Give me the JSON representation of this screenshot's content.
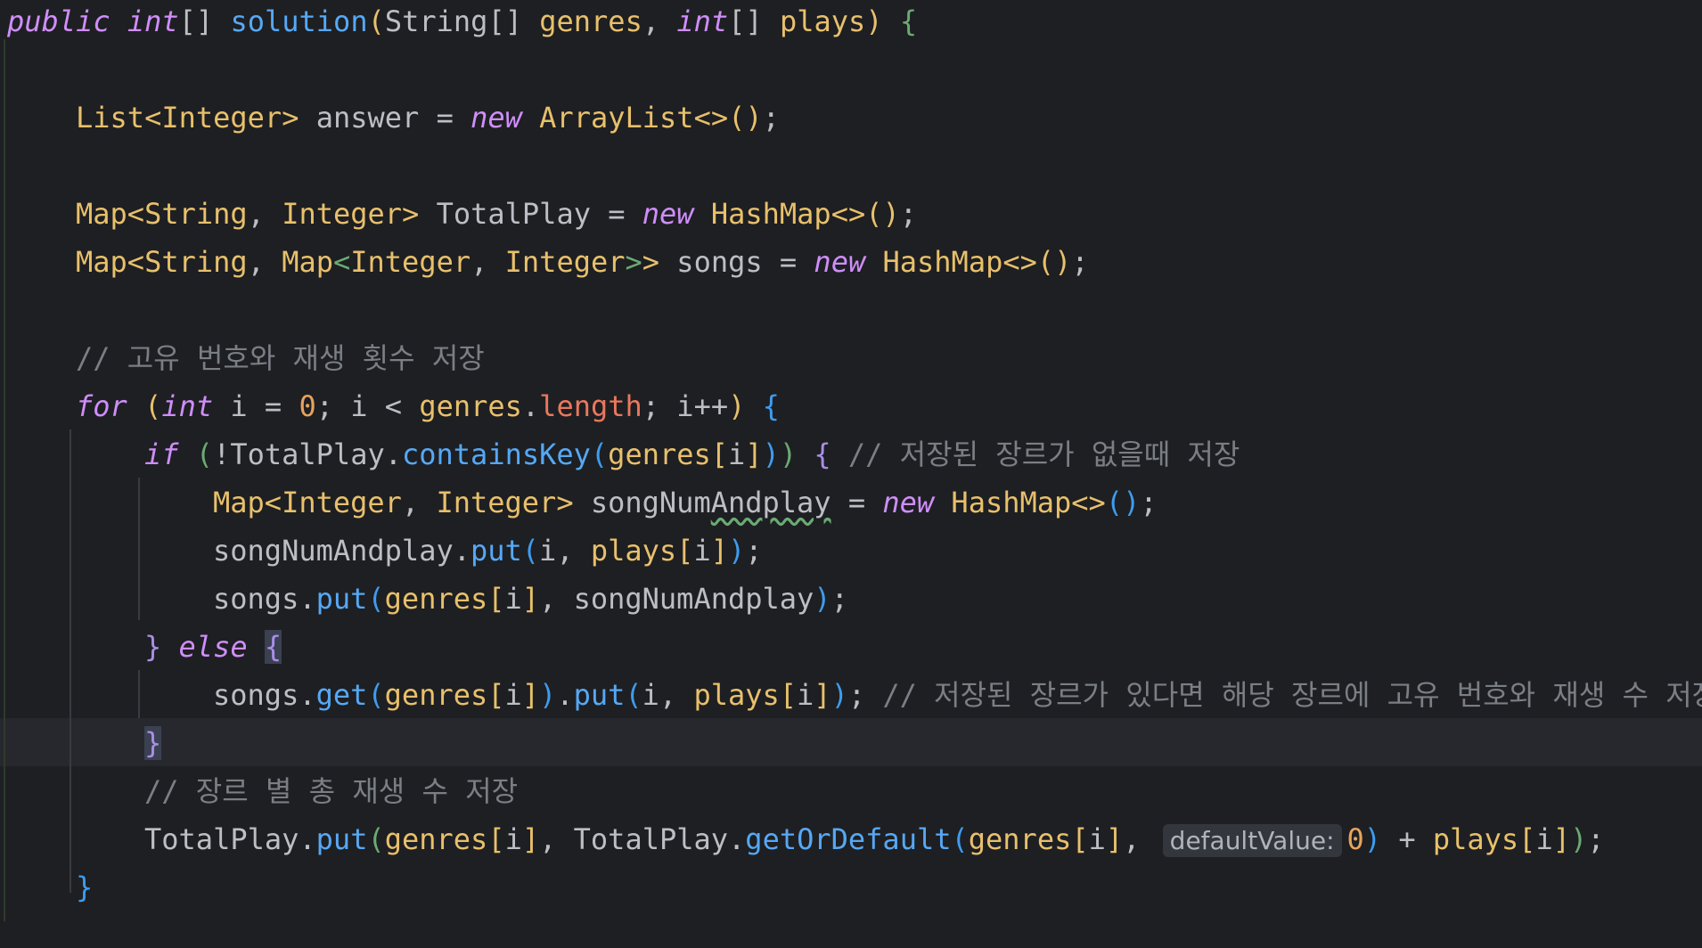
{
  "editor": {
    "lines": [
      {
        "indent": 0,
        "tokens": [
          {
            "t": "public",
            "c": "kw"
          },
          {
            "t": " ",
            "c": "var"
          },
          {
            "t": "int",
            "c": "kw"
          },
          {
            "t": "[] ",
            "c": "var"
          },
          {
            "t": "solution",
            "c": "fn"
          },
          {
            "t": "(",
            "c": "brY"
          },
          {
            "t": "String",
            "c": "var"
          },
          {
            "t": "[] ",
            "c": "var"
          },
          {
            "t": "genres",
            "c": "type"
          },
          {
            "t": ", ",
            "c": "var"
          },
          {
            "t": "int",
            "c": "kw"
          },
          {
            "t": "[] ",
            "c": "var"
          },
          {
            "t": "plays",
            "c": "type"
          },
          {
            "t": ") ",
            "c": "brY"
          },
          {
            "t": "{",
            "c": "brG"
          }
        ]
      },
      {
        "indent": 0,
        "tokens": []
      },
      {
        "indent": 1,
        "tokens": [
          {
            "t": "List<Integer>",
            "c": "type"
          },
          {
            "t": " answer = ",
            "c": "var"
          },
          {
            "t": "new",
            "c": "kw"
          },
          {
            "t": " ",
            "c": "var"
          },
          {
            "t": "ArrayList<>()",
            "c": "type"
          },
          {
            "t": ";",
            "c": "var"
          }
        ]
      },
      {
        "indent": 0,
        "tokens": []
      },
      {
        "indent": 1,
        "tokens": [
          {
            "t": "Map<String",
            "c": "type"
          },
          {
            "t": ", ",
            "c": "var"
          },
          {
            "t": "Integer>",
            "c": "type"
          },
          {
            "t": " TotalPlay = ",
            "c": "var"
          },
          {
            "t": "new",
            "c": "kw"
          },
          {
            "t": " ",
            "c": "var"
          },
          {
            "t": "HashMap<>()",
            "c": "type"
          },
          {
            "t": ";",
            "c": "var"
          }
        ]
      },
      {
        "indent": 1,
        "tokens": [
          {
            "t": "Map<String",
            "c": "type"
          },
          {
            "t": ", ",
            "c": "var"
          },
          {
            "t": "Map",
            "c": "type"
          },
          {
            "t": "<",
            "c": "brG"
          },
          {
            "t": "Integer",
            "c": "type"
          },
          {
            "t": ", ",
            "c": "var"
          },
          {
            "t": "Integer",
            "c": "type"
          },
          {
            "t": ">",
            "c": "brG"
          },
          {
            "t": ">",
            "c": "type"
          },
          {
            "t": " songs = ",
            "c": "var"
          },
          {
            "t": "new",
            "c": "kw"
          },
          {
            "t": " ",
            "c": "var"
          },
          {
            "t": "HashMap<>()",
            "c": "type"
          },
          {
            "t": ";",
            "c": "var"
          }
        ]
      },
      {
        "indent": 0,
        "tokens": []
      },
      {
        "indent": 1,
        "tokens": [
          {
            "t": "// 고유 번호와 재생 횟수 저장",
            "c": "cmt"
          }
        ]
      },
      {
        "indent": 1,
        "tokens": [
          {
            "t": "for",
            "c": "kw"
          },
          {
            "t": " ",
            "c": "var"
          },
          {
            "t": "(",
            "c": "brY"
          },
          {
            "t": "int",
            "c": "kw"
          },
          {
            "t": " i = ",
            "c": "var"
          },
          {
            "t": "0",
            "c": "num"
          },
          {
            "t": "; i < ",
            "c": "var"
          },
          {
            "t": "genres",
            "c": "type"
          },
          {
            "t": ".",
            "c": "var"
          },
          {
            "t": "length",
            "c": "fld"
          },
          {
            "t": "; i++",
            "c": "var"
          },
          {
            "t": ") ",
            "c": "brY"
          },
          {
            "t": "{",
            "c": "brB"
          }
        ]
      },
      {
        "indent": 2,
        "tokens": [
          {
            "t": "if",
            "c": "kw"
          },
          {
            "t": " ",
            "c": "var"
          },
          {
            "t": "(",
            "c": "brG"
          },
          {
            "t": "!TotalPlay.",
            "c": "var"
          },
          {
            "t": "containsKey",
            "c": "fn"
          },
          {
            "t": "(",
            "c": "brB"
          },
          {
            "t": "genres",
            "c": "type"
          },
          {
            "t": "[",
            "c": "brY"
          },
          {
            "t": "i",
            "c": "var"
          },
          {
            "t": "]",
            "c": "brY"
          },
          {
            "t": ")",
            "c": "brB"
          },
          {
            "t": ") ",
            "c": "brG"
          },
          {
            "t": "{",
            "c": "brP"
          },
          {
            "t": " ",
            "c": "var"
          },
          {
            "t": "// 저장된 장르가 없을때 저장",
            "c": "cmt"
          }
        ]
      },
      {
        "indent": 3,
        "tokens": [
          {
            "t": "Map<Integer",
            "c": "type"
          },
          {
            "t": ", ",
            "c": "var"
          },
          {
            "t": "Integer>",
            "c": "type"
          },
          {
            "t": " songNum",
            "c": "var"
          },
          {
            "t": "Andplay",
            "c": "typo"
          },
          {
            "t": " = ",
            "c": "var"
          },
          {
            "t": "new",
            "c": "kw"
          },
          {
            "t": " ",
            "c": "var"
          },
          {
            "t": "HashMap<>",
            "c": "type"
          },
          {
            "t": "()",
            "c": "brB"
          },
          {
            "t": ";",
            "c": "var"
          }
        ]
      },
      {
        "indent": 3,
        "tokens": [
          {
            "t": "songNumAndplay.",
            "c": "var"
          },
          {
            "t": "put",
            "c": "fn"
          },
          {
            "t": "(",
            "c": "brB"
          },
          {
            "t": "i, ",
            "c": "var"
          },
          {
            "t": "plays",
            "c": "type"
          },
          {
            "t": "[",
            "c": "brY"
          },
          {
            "t": "i",
            "c": "var"
          },
          {
            "t": "]",
            "c": "brY"
          },
          {
            "t": ")",
            "c": "brB"
          },
          {
            "t": ";",
            "c": "var"
          }
        ]
      },
      {
        "indent": 3,
        "tokens": [
          {
            "t": "songs.",
            "c": "var"
          },
          {
            "t": "put",
            "c": "fn"
          },
          {
            "t": "(",
            "c": "brB"
          },
          {
            "t": "genres",
            "c": "type"
          },
          {
            "t": "[",
            "c": "brY"
          },
          {
            "t": "i",
            "c": "var"
          },
          {
            "t": "]",
            "c": "brY"
          },
          {
            "t": ", songNumAndplay",
            "c": "var"
          },
          {
            "t": ")",
            "c": "brB"
          },
          {
            "t": ";",
            "c": "var"
          }
        ]
      },
      {
        "indent": 2,
        "tokens": [
          {
            "t": "}",
            "c": "brP"
          },
          {
            "t": " ",
            "c": "var"
          },
          {
            "t": "else",
            "c": "kw"
          },
          {
            "t": " ",
            "c": "var"
          },
          {
            "t": "{",
            "c": "brP match"
          }
        ]
      },
      {
        "indent": 3,
        "tokens": [
          {
            "t": "songs.",
            "c": "var"
          },
          {
            "t": "get",
            "c": "fn"
          },
          {
            "t": "(",
            "c": "brB"
          },
          {
            "t": "genres",
            "c": "type"
          },
          {
            "t": "[",
            "c": "brY"
          },
          {
            "t": "i",
            "c": "var"
          },
          {
            "t": "]",
            "c": "brY"
          },
          {
            "t": ")",
            "c": "brB"
          },
          {
            "t": ".",
            "c": "var"
          },
          {
            "t": "put",
            "c": "fn"
          },
          {
            "t": "(",
            "c": "brB"
          },
          {
            "t": "i, ",
            "c": "var"
          },
          {
            "t": "plays",
            "c": "type"
          },
          {
            "t": "[",
            "c": "brY"
          },
          {
            "t": "i",
            "c": "var"
          },
          {
            "t": "]",
            "c": "brY"
          },
          {
            "t": ")",
            "c": "brB"
          },
          {
            "t": "; ",
            "c": "var"
          },
          {
            "t": "// 저장된 장르가 있다면 해당 장르에 고유 번호와 재생 수 저장",
            "c": "cmt"
          }
        ]
      },
      {
        "indent": 2,
        "tokens": [
          {
            "t": "}",
            "c": "brP match"
          }
        ]
      },
      {
        "indent": 2,
        "tokens": [
          {
            "t": "// 장르 별 총 재생 수 저장",
            "c": "cmt"
          }
        ]
      },
      {
        "indent": 2,
        "tokens": [
          {
            "t": "TotalPlay.",
            "c": "var"
          },
          {
            "t": "put",
            "c": "fn"
          },
          {
            "t": "(",
            "c": "brG"
          },
          {
            "t": "genres",
            "c": "type"
          },
          {
            "t": "[",
            "c": "brY"
          },
          {
            "t": "i",
            "c": "var"
          },
          {
            "t": "]",
            "c": "brY"
          },
          {
            "t": ", TotalPlay.",
            "c": "var"
          },
          {
            "t": "getOrDefault",
            "c": "fn"
          },
          {
            "t": "(",
            "c": "brB"
          },
          {
            "t": "genres",
            "c": "type"
          },
          {
            "t": "[",
            "c": "brY"
          },
          {
            "t": "i",
            "c": "var"
          },
          {
            "t": "]",
            "c": "brY"
          },
          {
            "t": ", ",
            "c": "var"
          },
          {
            "t": "defaultValue:",
            "c": "hint"
          },
          {
            "t": "0",
            "c": "num"
          },
          {
            "t": ")",
            "c": "brB"
          },
          {
            "t": " + ",
            "c": "var"
          },
          {
            "t": "plays",
            "c": "type"
          },
          {
            "t": "[",
            "c": "brY"
          },
          {
            "t": "i",
            "c": "var"
          },
          {
            "t": "]",
            "c": "brY"
          },
          {
            "t": ")",
            "c": "brG"
          },
          {
            "t": ";",
            "c": "var"
          }
        ]
      },
      {
        "indent": 1,
        "tokens": [
          {
            "t": "}",
            "c": "brB"
          }
        ]
      }
    ]
  }
}
